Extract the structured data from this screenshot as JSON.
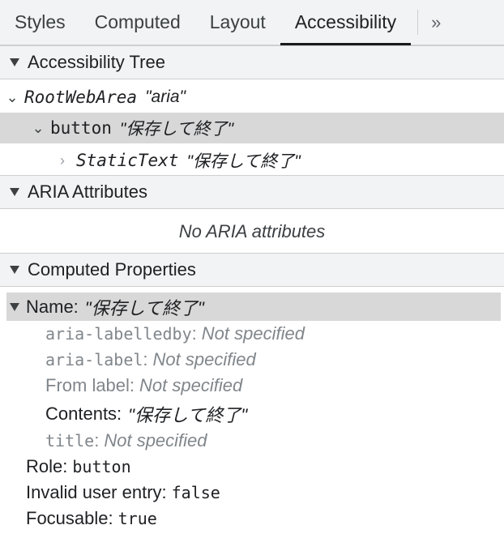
{
  "tabs": [
    "Styles",
    "Computed",
    "Layout",
    "Accessibility"
  ],
  "tab_more": "»",
  "accessibility_tree": {
    "header": "Accessibility Tree",
    "root": {
      "role": "RootWebArea",
      "name": "\"aria\""
    },
    "button": {
      "role": "button",
      "name": "\"保存して終了\""
    },
    "static_text": {
      "role": "StaticText",
      "name": "\"保存して終了\""
    }
  },
  "aria_attributes": {
    "header": "ARIA Attributes",
    "empty_text": "No ARIA attributes"
  },
  "computed_properties": {
    "header": "Computed Properties",
    "name_label": "Name:",
    "name_value": "\"保存して終了\"",
    "sources": [
      {
        "key": "aria-labelledby",
        "sep": ":",
        "value": "Not specified"
      },
      {
        "key": "aria-label",
        "sep": ":",
        "value": "Not specified"
      },
      {
        "key": "From label:",
        "value": "Not specified"
      },
      {
        "key": "Contents:",
        "value": "\"保存して終了\""
      },
      {
        "key": "title",
        "sep": ":",
        "value": "Not specified"
      }
    ],
    "role_label": "Role:",
    "role_value": "button",
    "invalid_label": "Invalid user entry:",
    "invalid_value": "false",
    "focusable_label": "Focusable:",
    "focusable_value": "true"
  }
}
